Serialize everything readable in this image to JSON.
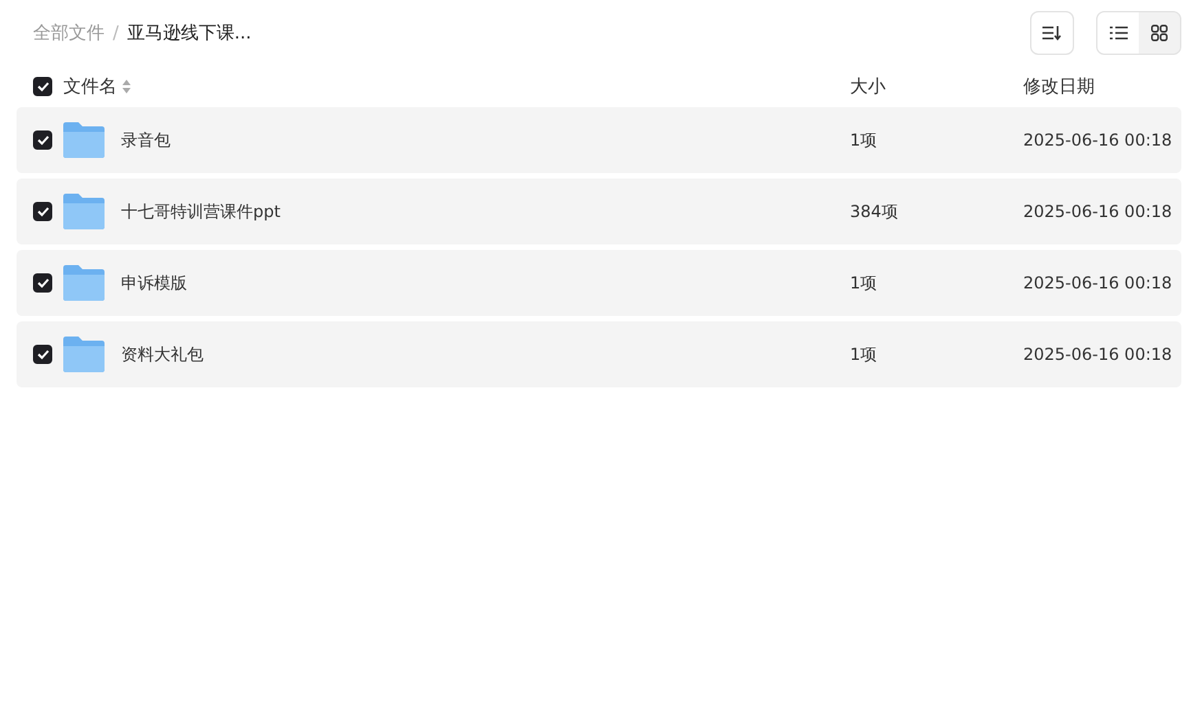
{
  "breadcrumb_separator": "/",
  "breadcrumb": [
    {
      "label": "全部文件",
      "current": false
    },
    {
      "label": "亚马逊线下课...",
      "current": true
    }
  ],
  "view_modes": [
    {
      "kind": "list",
      "selected": true
    },
    {
      "kind": "grid",
      "selected": false
    }
  ],
  "table": {
    "select_all_checked": true,
    "columns": [
      "文件名",
      "大小",
      "修改日期"
    ],
    "rows": [
      {
        "name": "录音包",
        "size": "1项",
        "modified": "2025-06-16 00:18",
        "checked": true
      },
      {
        "name": "十七哥特训营课件ppt",
        "size": "384项",
        "modified": "2025-06-16 00:18",
        "checked": true
      },
      {
        "name": "申诉模版",
        "size": "1项",
        "modified": "2025-06-16 00:18",
        "checked": true
      },
      {
        "name": "资料大礼包",
        "size": "1项",
        "modified": "2025-06-16 00:18",
        "checked": true
      }
    ]
  }
}
